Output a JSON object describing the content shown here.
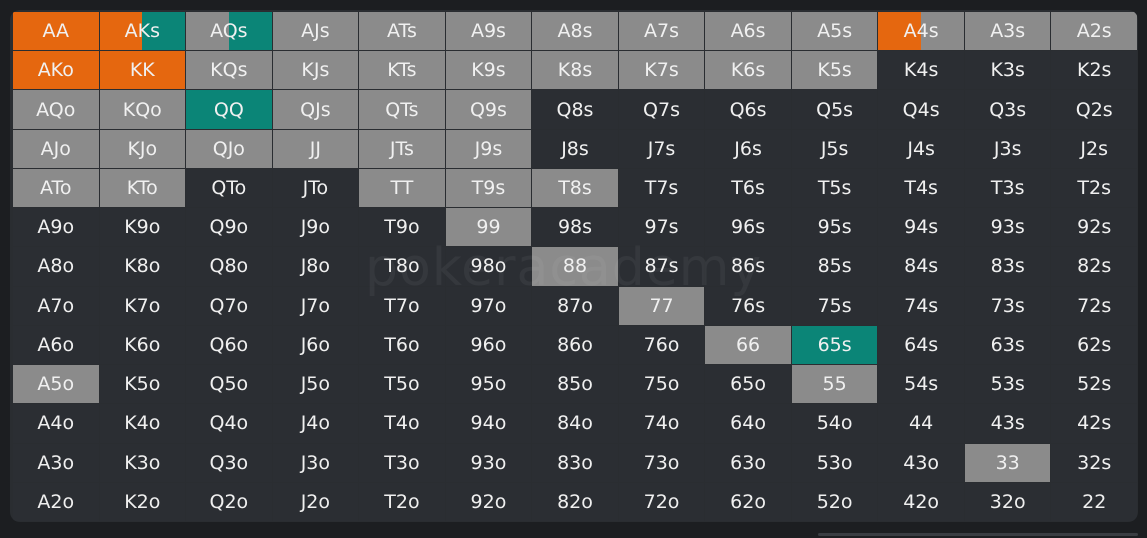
{
  "watermark": "pokeracademy",
  "colors": {
    "allin": "#e5670f",
    "raise": "#8b8b8b",
    "call": "#0b8577",
    "fold": "#2b2e33"
  },
  "legend": {
    "A": "allin",
    "R": "raise",
    "C": "call",
    "F": "fold"
  },
  "matrix": [
    [
      "AA",
      "AKs",
      "AQs",
      "AJs",
      "ATs",
      "A9s",
      "A8s",
      "A7s",
      "A6s",
      "A5s",
      "A4s",
      "A3s",
      "A2s"
    ],
    [
      "AKo",
      "KK",
      "KQs",
      "KJs",
      "KTs",
      "K9s",
      "K8s",
      "K7s",
      "K6s",
      "K5s",
      "K4s",
      "K3s",
      "K2s"
    ],
    [
      "AQo",
      "KQo",
      "QQ",
      "QJs",
      "QTs",
      "Q9s",
      "Q8s",
      "Q7s",
      "Q6s",
      "Q5s",
      "Q4s",
      "Q3s",
      "Q2s"
    ],
    [
      "AJo",
      "KJo",
      "QJo",
      "JJ",
      "JTs",
      "J9s",
      "J8s",
      "J7s",
      "J6s",
      "J5s",
      "J4s",
      "J3s",
      "J2s"
    ],
    [
      "ATo",
      "KTo",
      "QTo",
      "JTo",
      "TT",
      "T9s",
      "T8s",
      "T7s",
      "T6s",
      "T5s",
      "T4s",
      "T3s",
      "T2s"
    ],
    [
      "A9o",
      "K9o",
      "Q9o",
      "J9o",
      "T9o",
      "99",
      "98s",
      "97s",
      "96s",
      "95s",
      "94s",
      "93s",
      "92s"
    ],
    [
      "A8o",
      "K8o",
      "Q8o",
      "J8o",
      "T8o",
      "98o",
      "88",
      "87s",
      "86s",
      "85s",
      "84s",
      "83s",
      "82s"
    ],
    [
      "A7o",
      "K7o",
      "Q7o",
      "J7o",
      "T7o",
      "97o",
      "87o",
      "77",
      "76s",
      "75s",
      "74s",
      "73s",
      "72s"
    ],
    [
      "A6o",
      "K6o",
      "Q6o",
      "J6o",
      "T6o",
      "96o",
      "86o",
      "76o",
      "66",
      "65s",
      "64s",
      "63s",
      "62s"
    ],
    [
      "A5o",
      "K5o",
      "Q5o",
      "J5o",
      "T5o",
      "95o",
      "85o",
      "75o",
      "65o",
      "55",
      "54s",
      "53s",
      "52s"
    ],
    [
      "A4o",
      "K4o",
      "Q4o",
      "J4o",
      "T4o",
      "94o",
      "84o",
      "74o",
      "64o",
      "54o",
      "44",
      "43s",
      "42s"
    ],
    [
      "A3o",
      "K3o",
      "Q3o",
      "J3o",
      "T3o",
      "93o",
      "83o",
      "73o",
      "63o",
      "53o",
      "43o",
      "33",
      "32s"
    ],
    [
      "A2o",
      "K2o",
      "Q2o",
      "J2o",
      "T2o",
      "92o",
      "82o",
      "72o",
      "62o",
      "52o",
      "42o",
      "32o",
      "22"
    ]
  ],
  "actions": [
    [
      "A",
      "AC",
      "RC",
      "R",
      "R",
      "R",
      "R",
      "R",
      "R",
      "R",
      "AR",
      "R",
      "R"
    ],
    [
      "A",
      "A",
      "R",
      "R",
      "R",
      "R",
      "R",
      "R",
      "R",
      "R",
      "F",
      "F",
      "F"
    ],
    [
      "R",
      "R",
      "C",
      "R",
      "R",
      "R",
      "F",
      "F",
      "F",
      "F",
      "F",
      "F",
      "F"
    ],
    [
      "R",
      "R",
      "R",
      "R",
      "R",
      "R",
      "F",
      "F",
      "F",
      "F",
      "F",
      "F",
      "F"
    ],
    [
      "R",
      "R",
      "F",
      "F",
      "R",
      "R",
      "R",
      "F",
      "F",
      "F",
      "F",
      "F",
      "F"
    ],
    [
      "F",
      "F",
      "F",
      "F",
      "F",
      "R",
      "F",
      "F",
      "F",
      "F",
      "F",
      "F",
      "F"
    ],
    [
      "F",
      "F",
      "F",
      "F",
      "F",
      "F",
      "R",
      "F",
      "F",
      "F",
      "F",
      "F",
      "F"
    ],
    [
      "F",
      "F",
      "F",
      "F",
      "F",
      "F",
      "F",
      "R",
      "F",
      "F",
      "F",
      "F",
      "F"
    ],
    [
      "F",
      "F",
      "F",
      "F",
      "F",
      "F",
      "F",
      "F",
      "R",
      "C",
      "F",
      "F",
      "F"
    ],
    [
      "R",
      "F",
      "F",
      "F",
      "F",
      "F",
      "F",
      "F",
      "F",
      "R",
      "F",
      "F",
      "F"
    ],
    [
      "F",
      "F",
      "F",
      "F",
      "F",
      "F",
      "F",
      "F",
      "F",
      "F",
      "F",
      "F",
      "F"
    ],
    [
      "F",
      "F",
      "F",
      "F",
      "F",
      "F",
      "F",
      "F",
      "F",
      "F",
      "F",
      "R",
      "F"
    ],
    [
      "F",
      "F",
      "F",
      "F",
      "F",
      "F",
      "F",
      "F",
      "F",
      "F",
      "F",
      "F",
      "F"
    ]
  ],
  "splits": {
    "0,1": 0.5,
    "0,2": 0.5,
    "0,10": 0.5
  }
}
